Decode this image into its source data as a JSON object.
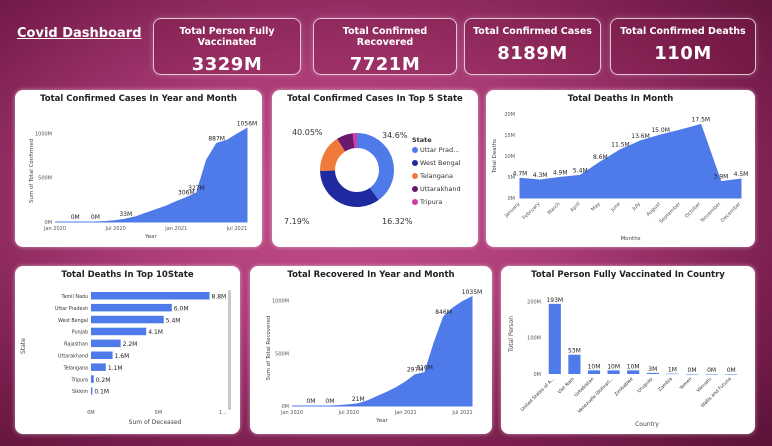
{
  "dashboard": {
    "title": "Covid Dashboard"
  },
  "kpis": [
    {
      "label": "Total Person Fully Vaccinated",
      "value": "3329M"
    },
    {
      "label": "Total Confirmed Recovered",
      "value": "7721M"
    },
    {
      "label": "Total Confirmed Cases",
      "value": "8189M"
    },
    {
      "label": "Total Confirmed Deaths",
      "value": "110M"
    }
  ],
  "colors": {
    "primary": "#4f7bea",
    "dark_blue": "#1f2aa0",
    "orange": "#f07a3c",
    "purple": "#6a1a6e",
    "magenta": "#d23aa8"
  },
  "chart_data": [
    {
      "id": "cases_ym",
      "type": "area",
      "title": "Total Confirmed Cases In Year and Month",
      "xlabel": "Year",
      "ylabel": "Sum of Total Confirmed",
      "ylim": [
        0,
        1150
      ],
      "yticks": [
        {
          "v": 0,
          "label": "0M"
        },
        {
          "v": 500,
          "label": "500M"
        },
        {
          "v": 1000,
          "label": "1000M"
        }
      ],
      "xticks": [
        {
          "x": 0,
          "label": "Jan 2020"
        },
        {
          "x": 6,
          "label": "Jul 2020"
        },
        {
          "x": 12,
          "label": "Jan 2021"
        },
        {
          "x": 18,
          "label": "Jul 2021"
        }
      ],
      "x": [
        0,
        1,
        2,
        3,
        4,
        5,
        6,
        7,
        8,
        9,
        10,
        11,
        12,
        13,
        14,
        15,
        16,
        17,
        18,
        19
      ],
      "values": [
        0,
        0,
        0,
        0,
        0,
        5,
        15,
        33,
        60,
        100,
        140,
        180,
        230,
        275,
        327,
        700,
        887,
        920,
        990,
        1056
      ],
      "data_labels": [
        {
          "i": 2,
          "label": "0M"
        },
        {
          "i": 4,
          "label": "0M"
        },
        {
          "i": 7,
          "label": "33M"
        },
        {
          "i": 13,
          "label": "306M"
        },
        {
          "i": 14,
          "label": "327M"
        },
        {
          "i": 16,
          "label": "887M"
        },
        {
          "i": 19,
          "label": "1056M"
        }
      ]
    },
    {
      "id": "cases_top5",
      "type": "pie",
      "title": "Total Confirmed Cases In Top 5 State",
      "legend_title": "State",
      "categories": [
        "Uttar Prad...",
        "West Bengal",
        "Telangana",
        "Uttarakhand",
        "Tripura"
      ],
      "values": [
        40.05,
        34.6,
        16.32,
        7.19,
        1.84
      ],
      "colors": [
        "#4f7bea",
        "#1f2aa0",
        "#f07a3c",
        "#6a1a6e",
        "#d23aa8"
      ],
      "data_labels": [
        {
          "i": 0,
          "label": "40.05%"
        },
        {
          "i": 1,
          "label": "34.6%"
        },
        {
          "i": 2,
          "label": "16.32%"
        },
        {
          "i": 3,
          "label": "7.19%"
        }
      ]
    },
    {
      "id": "deaths_month",
      "type": "area",
      "title": "Total Deaths In Month",
      "xlabel": "Months",
      "ylabel": "Total Deaths",
      "ylim": [
        0,
        20
      ],
      "yticks": [
        {
          "v": 0,
          "label": "0M"
        },
        {
          "v": 5,
          "label": "5M"
        },
        {
          "v": 10,
          "label": "10M"
        },
        {
          "v": 15,
          "label": "15M"
        },
        {
          "v": 20,
          "label": "20M"
        }
      ],
      "categories": [
        "January",
        "February",
        "March",
        "April",
        "May",
        "June",
        "July",
        "August",
        "September",
        "October",
        "November",
        "December"
      ],
      "values": [
        4.7,
        4.3,
        4.9,
        5.4,
        8.6,
        11.5,
        13.6,
        15.0,
        16.2,
        17.5,
        3.9,
        4.5
      ],
      "data_labels": [
        {
          "i": 0,
          "label": "4.7M"
        },
        {
          "i": 1,
          "label": "4.3M"
        },
        {
          "i": 2,
          "label": "4.9M"
        },
        {
          "i": 3,
          "label": "5.4M"
        },
        {
          "i": 4,
          "label": "8.6M"
        },
        {
          "i": 5,
          "label": "11.5M"
        },
        {
          "i": 6,
          "label": "13.6M"
        },
        {
          "i": 7,
          "label": "15.0M"
        },
        {
          "i": 9,
          "label": "17.5M"
        },
        {
          "i": 10,
          "label": "3.9M"
        },
        {
          "i": 11,
          "label": "4.5M"
        }
      ]
    },
    {
      "id": "deaths_top10",
      "type": "bar",
      "title": "Total Deaths In Top 10State",
      "xlabel": "Sum of Deceased",
      "ylabel": "State",
      "xlim": [
        0,
        9.8
      ],
      "xticks": [
        {
          "v": 0,
          "label": "0M"
        },
        {
          "v": 5,
          "label": "5M"
        },
        {
          "v": 9.8,
          "label": "1..."
        }
      ],
      "categories": [
        "Tamil Nadu",
        "Uttar Pradesh",
        "West Bengal",
        "Punjab",
        "Rajasthan",
        "Uttarakhand",
        "Telangana",
        "Tripura",
        "Sikkim"
      ],
      "values": [
        8.8,
        6.0,
        5.4,
        4.1,
        2.2,
        1.6,
        1.1,
        0.2,
        0.1
      ],
      "value_labels": [
        "8.8M",
        "6.0M",
        "5.4M",
        "4.1M",
        "2.2M",
        "1.6M",
        "1.1M",
        "0.2M",
        "0.1M"
      ]
    },
    {
      "id": "recovered_ym",
      "type": "area",
      "title": "Total Recovered In Year and Month",
      "xlabel": "Year",
      "ylabel": "Sum of Total Recovered",
      "ylim": [
        0,
        1100
      ],
      "yticks": [
        {
          "v": 0,
          "label": "0M"
        },
        {
          "v": 500,
          "label": "500M"
        },
        {
          "v": 1000,
          "label": "1000M"
        }
      ],
      "xticks": [
        {
          "x": 0,
          "label": "Jan 2020"
        },
        {
          "x": 6,
          "label": "Jul 2020"
        },
        {
          "x": 12,
          "label": "Jan 2021"
        },
        {
          "x": 18,
          "label": "Jul 2021"
        }
      ],
      "x": [
        0,
        1,
        2,
        3,
        4,
        5,
        6,
        7,
        8,
        9,
        10,
        11,
        12,
        13,
        14,
        15,
        16,
        17,
        18,
        19
      ],
      "values": [
        0,
        0,
        0,
        0,
        0,
        5,
        12,
        21,
        50,
        90,
        130,
        175,
        230,
        297,
        316,
        600,
        846,
        930,
        990,
        1035
      ],
      "data_labels": [
        {
          "i": 2,
          "label": "0M"
        },
        {
          "i": 4,
          "label": "0M"
        },
        {
          "i": 7,
          "label": "21M"
        },
        {
          "i": 13,
          "label": "297M"
        },
        {
          "i": 14,
          "label": "316M"
        },
        {
          "i": 16,
          "label": "846M"
        },
        {
          "i": 19,
          "label": "1035M"
        }
      ]
    },
    {
      "id": "vaccinated_country",
      "type": "bar",
      "title": "Total Person Fully Vaccinated In Country",
      "xlabel": "Country",
      "ylabel": "Total Person",
      "ylim": [
        0,
        220
      ],
      "yticks": [
        {
          "v": 0,
          "label": "0M"
        },
        {
          "v": 100,
          "label": "100M"
        },
        {
          "v": 200,
          "label": "200M"
        }
      ],
      "categories": [
        "United States of A...",
        "Viet Nam",
        "Uzbekistan",
        "Venezuela (Bolivari...",
        "Zimbabwe",
        "Uruguay",
        "Zambia",
        "Yemen",
        "Vanuatu",
        "Wallis and Futuna"
      ],
      "values": [
        193,
        53,
        10,
        10,
        10,
        3,
        1,
        0,
        0,
        0
      ],
      "value_labels": [
        "193M",
        "53M",
        "10M",
        "10M",
        "10M",
        "3M",
        "1M",
        "0M",
        "0M",
        "0M"
      ]
    }
  ]
}
